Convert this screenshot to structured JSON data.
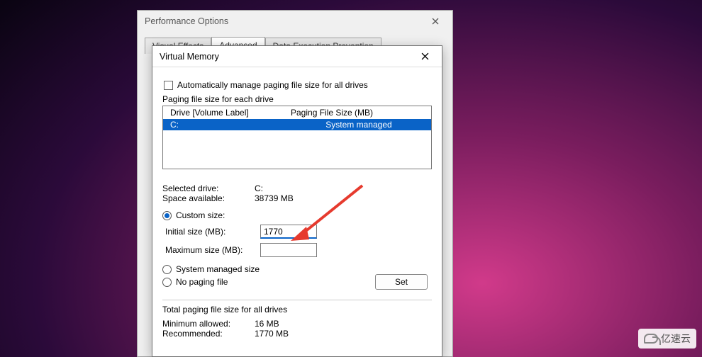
{
  "parent": {
    "title": "Performance Options",
    "tabs": [
      "Visual Effects",
      "Advanced",
      "Data Execution Prevention"
    ],
    "active_tab_index": 1
  },
  "vm": {
    "title": "Virtual Memory",
    "auto_manage_label": "Automatically manage paging file size for all drives",
    "auto_manage_checked": false,
    "group_label": "Paging file size for each drive",
    "col_drive": "Drive  [Volume Label]",
    "col_pfs": "Paging File Size (MB)",
    "drives": [
      {
        "name": "C:",
        "pfs": "System managed"
      }
    ],
    "selected_drive_label": "Selected drive:",
    "selected_drive_value": "C:",
    "space_avail_label": "Space available:",
    "space_avail_value": "38739 MB",
    "radio_custom": "Custom size:",
    "initial_label": "Initial size (MB):",
    "initial_value": "1770",
    "max_label": "Maximum size (MB):",
    "max_value": "",
    "radio_sysmanaged": "System managed size",
    "radio_nopaging": "No paging file",
    "set_btn": "Set",
    "totals_label": "Total paging file size for all drives",
    "min_allowed_label": "Minimum allowed:",
    "min_allowed_value": "16 MB",
    "recommended_label": "Recommended:",
    "recommended_value": "1770 MB"
  },
  "watermark": "亿速云"
}
